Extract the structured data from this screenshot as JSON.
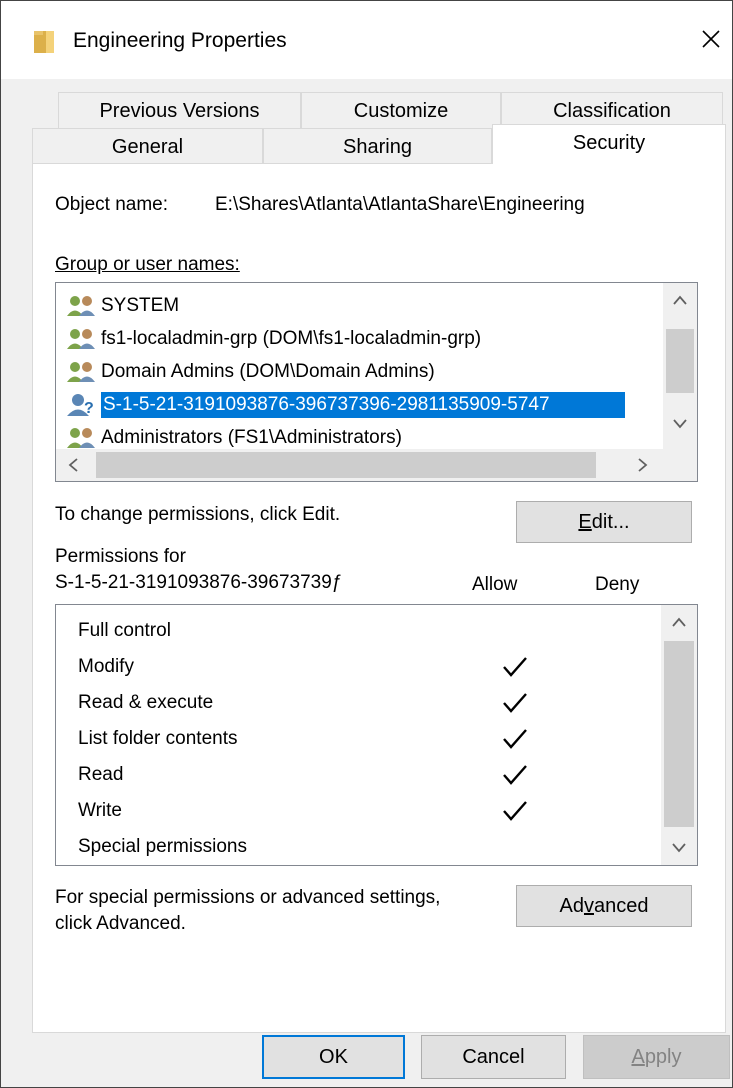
{
  "window": {
    "title": "Engineering Properties"
  },
  "tabs": {
    "row_back": [
      "Previous Versions",
      "Customize",
      "Classification"
    ],
    "row_front": [
      "General",
      "Sharing",
      "Security"
    ],
    "active": "Security"
  },
  "object": {
    "label": "Object name:",
    "value": "E:\\Shares\\Atlanta\\AtlantaShare\\Engineering"
  },
  "groups": {
    "label": "Group or user names:",
    "items": [
      {
        "name": "SYSTEM",
        "icon": "user-group-icon"
      },
      {
        "name": "fs1-localadmin-grp (DOM\\fs1-localadmin-grp)",
        "icon": "user-group-icon"
      },
      {
        "name": "Domain Admins (DOM\\Domain Admins)",
        "icon": "user-group-icon"
      },
      {
        "name": "S-1-5-21-3191093876-396737396-2981135909-5747",
        "icon": "unknown-user-icon",
        "selected": true
      },
      {
        "name": "Administrators (FS1\\Administrators)",
        "icon": "user-group-icon"
      }
    ]
  },
  "change_hint": "To change permissions, click Edit.",
  "edit_button": "Edit...",
  "permissions": {
    "label_line1": "Permissions for",
    "label_line2": "S-1-5-21-3191093876-39673739ƒ",
    "allow_header": "Allow",
    "deny_header": "Deny",
    "rows": [
      {
        "name": "Full control",
        "allow": false,
        "deny": false
      },
      {
        "name": "Modify",
        "allow": true,
        "deny": false
      },
      {
        "name": "Read & execute",
        "allow": true,
        "deny": false
      },
      {
        "name": "List folder contents",
        "allow": true,
        "deny": false
      },
      {
        "name": "Read",
        "allow": true,
        "deny": false
      },
      {
        "name": "Write",
        "allow": true,
        "deny": false
      },
      {
        "name": "Special permissions",
        "allow": false,
        "deny": false
      }
    ]
  },
  "advanced": {
    "hint_line1": "For special permissions or advanced settings,",
    "hint_line2": "click Advanced.",
    "button": "Advanced"
  },
  "footer": {
    "ok": "OK",
    "cancel": "Cancel",
    "apply": "Apply"
  },
  "colors": {
    "selection": "#0078d7",
    "background": "#f0f0f0"
  }
}
